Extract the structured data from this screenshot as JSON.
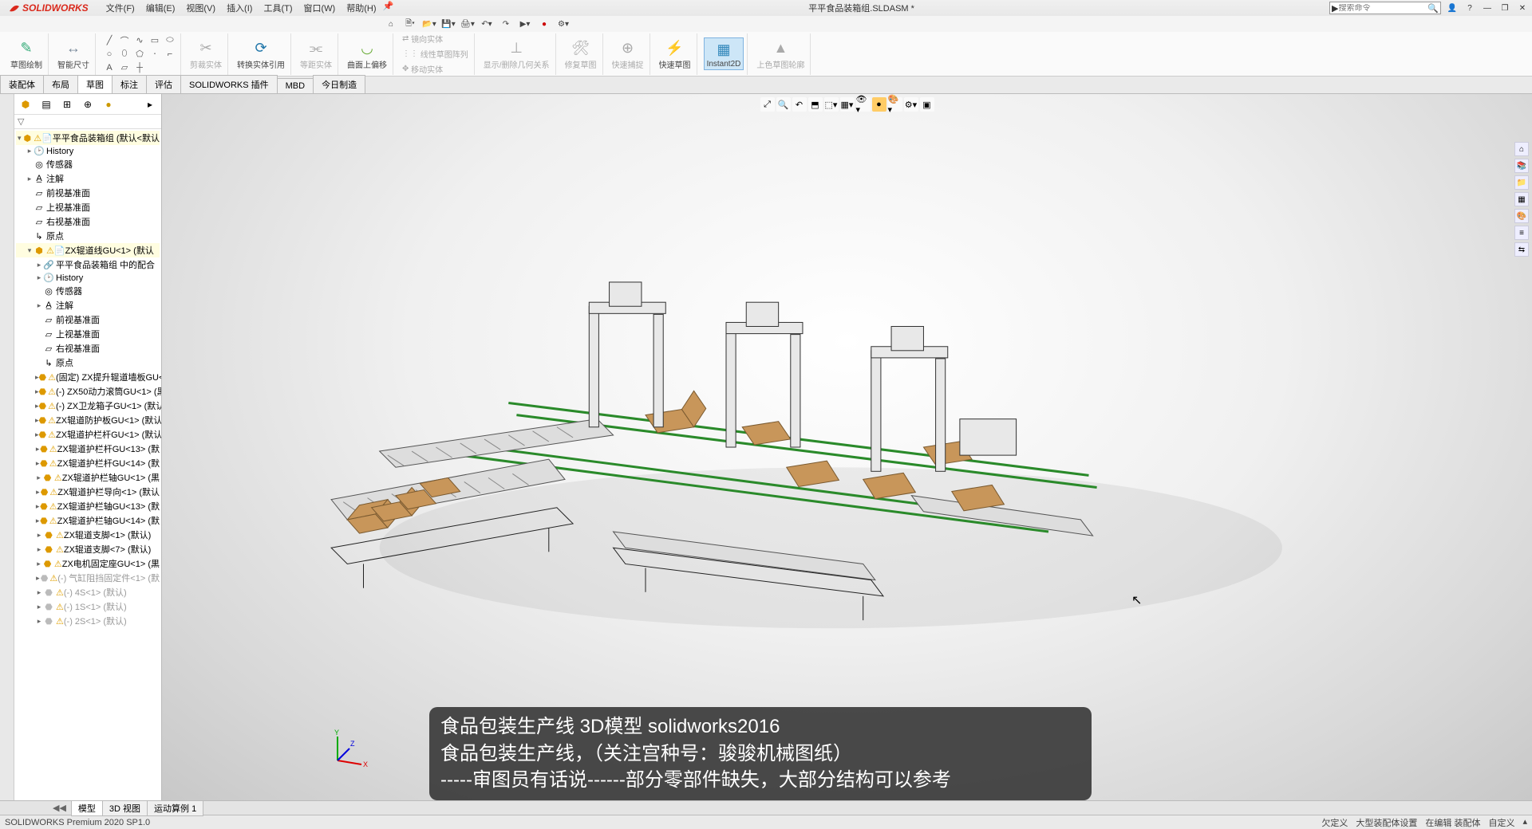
{
  "app_name": "SOLIDWORKS",
  "menus": [
    "文件(F)",
    "编辑(E)",
    "视图(V)",
    "插入(I)",
    "工具(T)",
    "窗口(W)",
    "帮助(H)"
  ],
  "document_title": "平平食品装箱组.SLDASM *",
  "search_placeholder": "搜索命令",
  "ribbon": {
    "sketch_draw": "草图绘制",
    "smart_dim": "智能尺寸",
    "trim": "剪裁实体",
    "convert": "转换实体引用",
    "offset": "等距实体",
    "offset_surf": "曲面上偏移",
    "mirror": "镜向实体",
    "pattern": "线性草图阵列",
    "move": "移动实体",
    "relations": "显示/删除几何关系",
    "repair": "修复草图",
    "quick_snap": "快速捕捉",
    "rapid": "快速草图",
    "instant": "Instant2D",
    "shade": "上色草图轮廓"
  },
  "tabs": [
    "装配体",
    "布局",
    "草图",
    "标注",
    "评估",
    "SOLIDWORKS 插件",
    "MBD",
    "今日制造"
  ],
  "active_tab": "草图",
  "tree_root": "平平食品装箱组  (默认<默认",
  "tree": {
    "history": "History",
    "sensors": "传感器",
    "annotations": "注解",
    "front": "前视基准面",
    "top": "上视基准面",
    "right": "右视基准面",
    "origin": "原点",
    "sub1": "ZX辊道线GU<1>  (默认",
    "sub1_mates": "平平食品装箱组 中的配合",
    "sub1_items": [
      "(固定) ZX提升辊道墙板GU<",
      "(-) ZX50动力滚筒GU<1> (黒",
      "(-) ZX卫龙箱子GU<1> (默认",
      "ZX辊道防护板GU<1> (默认",
      "ZX辊道护栏杆GU<1> (默认",
      "ZX辊道护栏杆GU<13> (默",
      "ZX辊道护栏杆GU<14> (默",
      "ZX辊道护栏轴GU<1> (黒",
      "ZX辊道护栏导向<1> (默认",
      "ZX辊道护栏轴GU<13> (默",
      "ZX辊道护栏轴GU<14> (默",
      "ZX辊道支脚<1> (默认)",
      "ZX辊道支脚<7> (默认)",
      "ZX电机固定座GU<1> (黒",
      "(-) 气缸阻挡固定件<1> (默",
      "(-) 4S<1> (默认)",
      "(-) 1S<1> (默认)",
      "(-) 2S<1> (默认)"
    ]
  },
  "bottom_tabs": [
    "模型",
    "3D 视图",
    "运动算例 1"
  ],
  "status_left": "SOLIDWORKS Premium 2020 SP1.0",
  "status_right": [
    "欠定义",
    "大型装配体设置",
    "在编辑 装配体",
    "自定义"
  ],
  "caption": {
    "l1": "食品包装生产线 3D模型 solidworks2016",
    "l2": "食品包装生产线，（关注宫种号：骏骏机械图纸）",
    "l3": "-----审图员有话说------部分零部件缺失，大部分结构可以参考"
  },
  "filter_hint": "▽"
}
